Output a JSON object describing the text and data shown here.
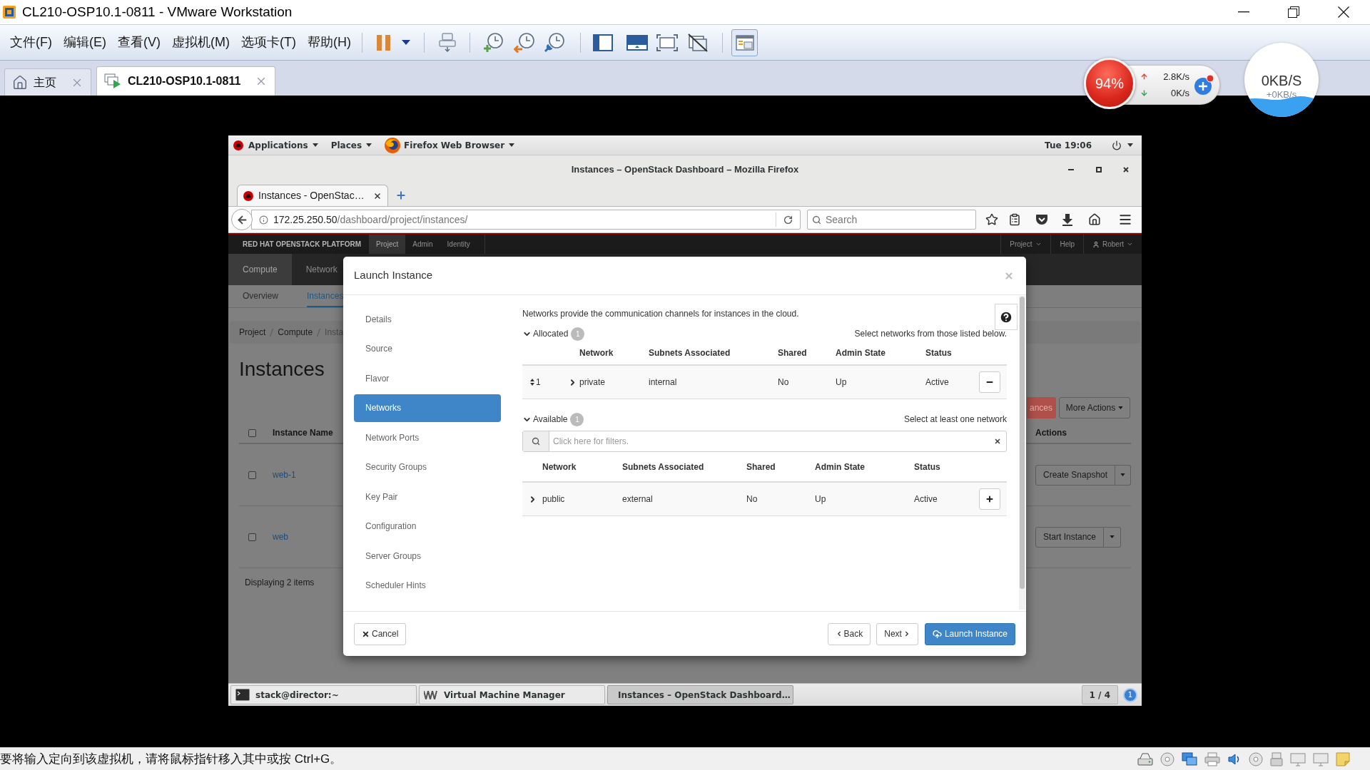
{
  "vmware": {
    "title": "CL210-OSP10.1-0811 - VMware Workstation",
    "menu": [
      "文件(F)",
      "编辑(E)",
      "查看(V)",
      "虚拟机(M)",
      "选项卡(T)",
      "帮助(H)"
    ],
    "tabs": [
      {
        "label": "主页",
        "kind": "home",
        "selected": false
      },
      {
        "label": "CL210-OSP10.1-0811",
        "kind": "vm",
        "selected": true
      }
    ],
    "status": "要将输入定向到该虚拟机，请将鼠标指针移入其中或按 Ctrl+G。"
  },
  "monitor": {
    "cpu": "94%",
    "upload": "2.8K/s",
    "download": "0K/s",
    "speed": "0KB/S",
    "speed_delta": "+0KB/s"
  },
  "gnome": {
    "menus": [
      "Applications",
      "Places",
      "Firefox Web Browser"
    ],
    "clock": "Tue 19:06",
    "taskbar": [
      {
        "label": "stack@director:~",
        "kind": "terminal",
        "selected": false
      },
      {
        "label": "Virtual Machine Manager",
        "kind": "vmm",
        "selected": false
      },
      {
        "label": "Instances – OpenStack Dashboard…",
        "kind": "firefox",
        "selected": true
      }
    ],
    "workspace": "1 / 4",
    "notifications": "1"
  },
  "firefox": {
    "title": "Instances – OpenStack Dashboard – Mozilla Firefox",
    "tab": "Instances - OpenStac…",
    "url_host": "172.25.250.50",
    "url_path": "/dashboard/project/instances/",
    "search": {
      "placeholder": "Search"
    }
  },
  "horizon": {
    "brand": "RED HAT OPENSTACK PLATFORM",
    "nav": [
      {
        "label": "Project",
        "selected": true
      },
      {
        "label": "Admin",
        "selected": false
      },
      {
        "label": "Identity",
        "selected": false
      }
    ],
    "project_menu": "Project",
    "help": "Help",
    "user": "Robert",
    "panels": [
      {
        "label": "Compute",
        "selected": true
      },
      {
        "label": "Network",
        "selected": false
      }
    ],
    "subnav": [
      {
        "label": "Overview",
        "selected": false
      },
      {
        "label": "Instances",
        "selected": true
      }
    ],
    "breadcrumb": [
      "Project",
      "Compute",
      "Insta"
    ],
    "heading": "Instances",
    "toolbar": {
      "danger_button": "ances",
      "more_actions": "More Actions"
    },
    "table": {
      "header_checked": false,
      "columns": [
        "Instance Name",
        "Actions"
      ],
      "rows": [
        {
          "name": "web-1",
          "action": "Create Snapshot",
          "checked": false
        },
        {
          "name": "web",
          "action": "Start Instance",
          "checked": false
        }
      ]
    },
    "footer": "Displaying 2 items"
  },
  "modal": {
    "title": "Launch Instance",
    "steps": [
      {
        "label": "Details",
        "selected": false
      },
      {
        "label": "Source",
        "selected": false
      },
      {
        "label": "Flavor",
        "selected": false
      },
      {
        "label": "Networks",
        "selected": true
      },
      {
        "label": "Network Ports",
        "selected": false
      },
      {
        "label": "Security Groups",
        "selected": false
      },
      {
        "label": "Key Pair",
        "selected": false
      },
      {
        "label": "Configuration",
        "selected": false
      },
      {
        "label": "Server Groups",
        "selected": false
      },
      {
        "label": "Scheduler Hints",
        "selected": false
      }
    ],
    "intro": "Networks provide the communication channels for instances in the cloud.",
    "sections": [
      {
        "kind": "allocated",
        "label": "Allocated",
        "count": "1",
        "expanded": true,
        "hint": "Select networks from those listed below.",
        "columns": [
          "Network",
          "Subnets Associated",
          "Shared",
          "Admin State",
          "Status"
        ],
        "rows": [
          {
            "kind": "remove",
            "order": "1",
            "expanded": false,
            "network": "private",
            "subnets": "internal",
            "shared": "No",
            "admin_state": "Up",
            "status": "Active"
          }
        ]
      },
      {
        "kind": "available",
        "label": "Available",
        "count": "1",
        "expanded": true,
        "hint": "Select at least one network",
        "filter": {
          "placeholder": "Click here for filters."
        },
        "columns": [
          "Network",
          "Subnets Associated",
          "Shared",
          "Admin State",
          "Status"
        ],
        "rows": [
          {
            "kind": "add",
            "expanded": false,
            "network": "public",
            "subnets": "external",
            "shared": "No",
            "admin_state": "Up",
            "status": "Active"
          }
        ]
      }
    ],
    "buttons": [
      {
        "kind": "cancel",
        "label": "Cancel"
      },
      {
        "kind": "back",
        "label": "Back"
      },
      {
        "kind": "next",
        "label": "Next"
      },
      {
        "kind": "launch",
        "label": "Launch Instance"
      }
    ]
  }
}
